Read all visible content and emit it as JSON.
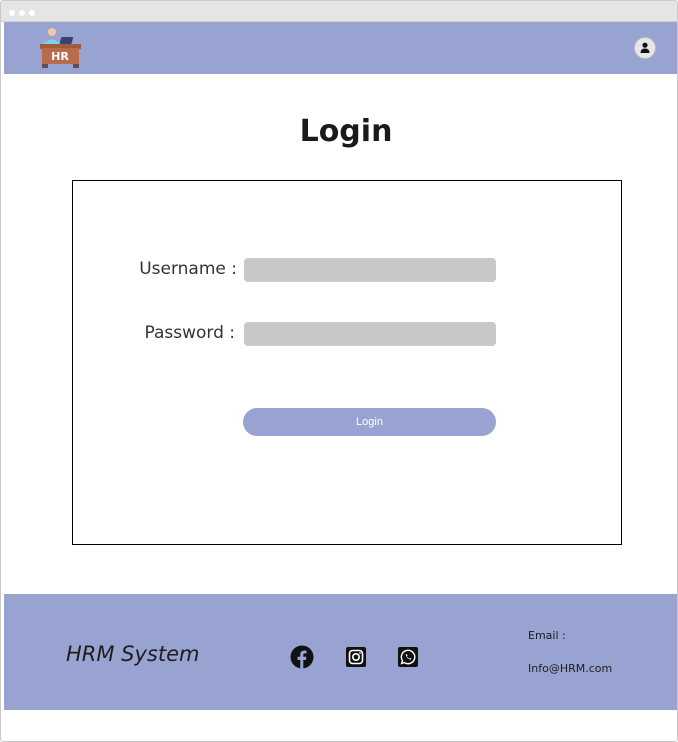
{
  "header": {
    "logo_text": "HR",
    "logo_icon": "hr-desk-logo",
    "user_icon": "user-icon"
  },
  "page": {
    "title": "Login"
  },
  "form": {
    "username_label": "Username :",
    "username_value": "",
    "password_label": "Password :",
    "password_value": "",
    "submit_label": "Login"
  },
  "footer": {
    "brand": "HRM System",
    "social": [
      "facebook-icon",
      "instagram-icon",
      "whatsapp-icon"
    ],
    "email_label": "Email :",
    "email_value": "Info@HRM.com"
  },
  "colors": {
    "accent": "#98a3d1",
    "input_bg": "#c8c8c8",
    "text": "#1e1e1e"
  }
}
